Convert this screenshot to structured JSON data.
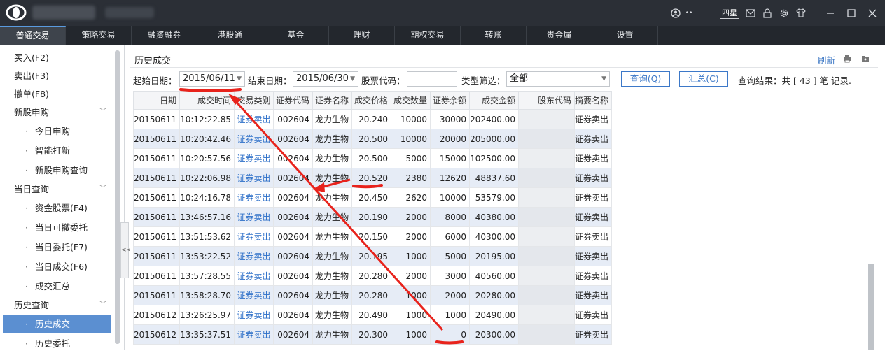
{
  "titlebar": {
    "level_badge": "四星",
    "icons": [
      "user-icon",
      "mail-icon",
      "lock-icon",
      "gear-icon",
      "shirt-icon",
      "minimize-icon",
      "maximize-icon",
      "close-icon"
    ]
  },
  "menu": {
    "items": [
      "普通交易",
      "策略交易",
      "融资融券",
      "港股通",
      "基金",
      "理财",
      "期权交易",
      "转账",
      "贵金属",
      "设置"
    ]
  },
  "sidebar": {
    "items": [
      {
        "label": "买入(F2)"
      },
      {
        "label": "卖出(F3)"
      },
      {
        "label": "撤单(F8)"
      },
      {
        "label": "新股申购"
      },
      {
        "label": "今日申购"
      },
      {
        "label": "智能打新"
      },
      {
        "label": "新股申购查询"
      },
      {
        "label": "当日查询"
      },
      {
        "label": "资金股票(F4)"
      },
      {
        "label": "当日可撤委托"
      },
      {
        "label": "当日委托(F7)"
      },
      {
        "label": "当日成交(F6)"
      },
      {
        "label": "成交汇总"
      },
      {
        "label": "历史查询"
      },
      {
        "label": "历史成交"
      },
      {
        "label": "历史委托"
      }
    ],
    "collapse_label": "<<"
  },
  "content": {
    "title": "历史成交",
    "refresh_label": "刷新",
    "filter": {
      "start_label": "起始日期：",
      "start_value": "2015/06/11",
      "end_label": "结束日期：",
      "end_value": "2015/06/30",
      "code_label": "股票代码：",
      "code_value": "",
      "type_label": "类型筛选：",
      "type_value": "全部",
      "query_button": "查询(Q)",
      "summary_button": "汇总(C)",
      "result_text": "查询结果：共 [ 43 ] 笔 记录."
    },
    "table": {
      "columns": [
        "日期",
        "成交时间",
        "交易类别",
        "证券代码",
        "证券名称",
        "成交价格",
        "成交数量",
        "证券余额",
        "成交金额",
        "股东代码",
        "摘要名称"
      ],
      "rows": [
        [
          "20150611",
          "10:12:22.85",
          "证券卖出",
          "002604",
          "龙力生物",
          "20.240",
          "10000",
          "30000",
          "202400.00",
          "",
          "证券卖出"
        ],
        [
          "20150611",
          "10:20:42.46",
          "证券卖出",
          "002604",
          "龙力生物",
          "20.500",
          "10000",
          "20000",
          "205000.00",
          "",
          "证券卖出"
        ],
        [
          "20150611",
          "10:20:57.56",
          "证券卖出",
          "002604",
          "龙力生物",
          "20.500",
          "5000",
          "15000",
          "102500.00",
          "",
          "证券卖出"
        ],
        [
          "20150611",
          "10:22:06.98",
          "证券卖出",
          "002604",
          "龙力生物",
          "20.520",
          "2380",
          "12620",
          "48837.60",
          "",
          "证券卖出"
        ],
        [
          "20150611",
          "10:24:16.78",
          "证券卖出",
          "002604",
          "龙力生物",
          "20.450",
          "2620",
          "10000",
          "53579.00",
          "",
          "证券卖出"
        ],
        [
          "20150611",
          "13:46:57.16",
          "证券卖出",
          "002604",
          "龙力生物",
          "20.190",
          "2000",
          "8000",
          "40380.00",
          "",
          "证券卖出"
        ],
        [
          "20150611",
          "13:51:53.62",
          "证券卖出",
          "002604",
          "龙力生物",
          "20.150",
          "2000",
          "6000",
          "40300.00",
          "",
          "证券卖出"
        ],
        [
          "20150611",
          "13:53:22.52",
          "证券卖出",
          "002604",
          "龙力生物",
          "20.195",
          "1000",
          "5000",
          "20195.00",
          "",
          "证券卖出"
        ],
        [
          "20150611",
          "13:57:28.55",
          "证券卖出",
          "002604",
          "龙力生物",
          "20.280",
          "2000",
          "3000",
          "40560.00",
          "",
          "证券卖出"
        ],
        [
          "20150611",
          "13:58:28.70",
          "证券卖出",
          "002604",
          "龙力生物",
          "20.280",
          "1000",
          "2000",
          "20280.00",
          "",
          "证券卖出"
        ],
        [
          "20150612",
          "13:26:25.97",
          "证券卖出",
          "002604",
          "龙力生物",
          "20.490",
          "1000",
          "1000",
          "20490.00",
          "",
          "证券卖出"
        ],
        [
          "20150612",
          "13:35:37.51",
          "证券卖出",
          "002604",
          "龙力生物",
          "20.300",
          "1000",
          "0",
          "20300.00",
          "",
          "证券卖出"
        ]
      ]
    }
  },
  "colors": {
    "titlebar_bg": "#2b2f36",
    "menubar_bg": "#23272d",
    "sidebar_active": "#5b8fd1",
    "link_blue": "#2d6fc8",
    "row_alt": "#e6ecf6",
    "annotation_red": "#e8231c"
  }
}
